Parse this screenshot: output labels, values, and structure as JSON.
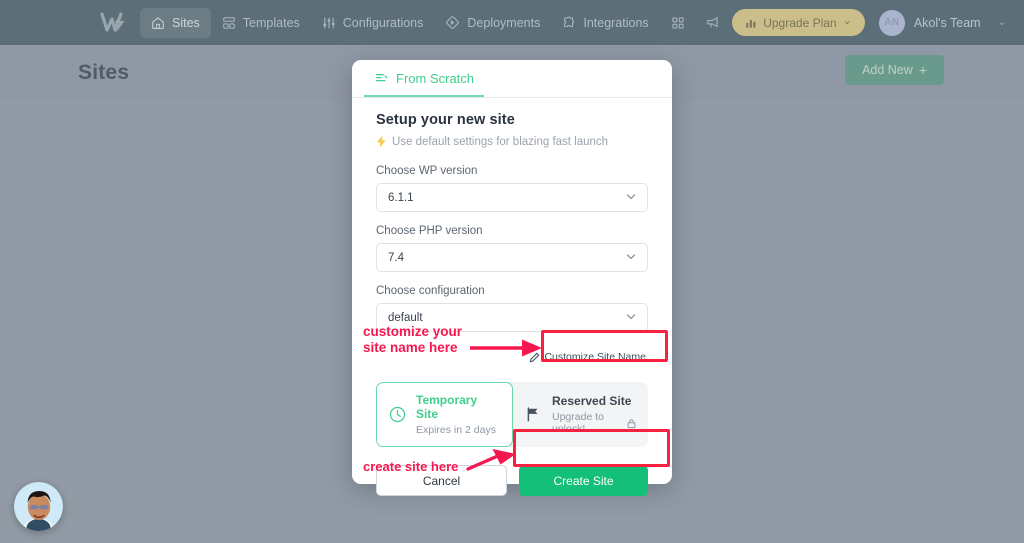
{
  "topnav": {
    "logo_icon": "wordpress-lightning-logo-icon",
    "items": [
      {
        "label": "Sites",
        "icon": "home-icon",
        "active": true
      },
      {
        "label": "Templates",
        "icon": "templates-grid-icon",
        "active": false
      },
      {
        "label": "Configurations",
        "icon": "sliders-icon",
        "active": false
      },
      {
        "label": "Deployments",
        "icon": "deploy-diamond-icon",
        "active": false
      },
      {
        "label": "Integrations",
        "icon": "puzzle-icon",
        "active": false
      }
    ],
    "apps_icon": "apps-grid-icon",
    "announce_icon": "megaphone-icon",
    "upgrade": {
      "label": "Upgrade Plan",
      "icon": "bar-chart-icon",
      "caret": "⌄"
    },
    "team": {
      "initials": "AN",
      "name": "Akol's Team",
      "caret": "⌄"
    }
  },
  "header": {
    "title": "Sites",
    "add_new_label": "Add New",
    "add_new_icon": "plus-icon"
  },
  "modal": {
    "tab": {
      "label": "From Scratch",
      "icon": "from-scratch-lines-icon"
    },
    "heading": "Setup your new site",
    "subheading": "Use default settings for blazing fast launch",
    "sub_icon": "lightning-bolt-icon",
    "fields": [
      {
        "label": "Choose WP version",
        "value": "6.1.1",
        "name": "wp-version"
      },
      {
        "label": "Choose PHP version",
        "value": "7.4",
        "name": "php-version"
      },
      {
        "label": "Choose configuration",
        "value": "default",
        "name": "configuration"
      }
    ],
    "customize_site_name": {
      "label": "Customize Site Name",
      "icon": "pencil-icon"
    },
    "site_types": [
      {
        "title": "Temporary Site",
        "subtitle": "Expires in 2 days",
        "icon": "clock-icon",
        "selected": true,
        "lock": ""
      },
      {
        "title": "Reserved Site",
        "subtitle": "Upgrade to unlock!",
        "icon": "flag-icon",
        "selected": false,
        "lock": "lock-icon"
      }
    ],
    "cancel_label": "Cancel",
    "create_label": "Create Site"
  },
  "annotations": [
    {
      "text": "customize your\nsite name here",
      "name": "annotation-customize-site-name"
    },
    {
      "text": "create site here",
      "name": "annotation-create-site"
    }
  ],
  "chat": {
    "avatar_alt": "support-agent-avatar"
  },
  "colors": {
    "nav_bg": "#5c6e77",
    "header_bg": "#9098a6",
    "overlay_bg": "#919aa5",
    "accent_green": "#13bf79",
    "tab_green": "#3ecf8e",
    "annotation_red": "#f6174e",
    "upgrade_gold": "#cbbe8a"
  }
}
